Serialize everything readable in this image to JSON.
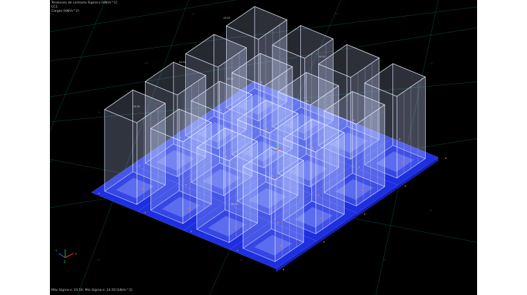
{
  "info": {
    "line1": "Tensiones de contacto Sigma-z [kN/m^2]",
    "line2": "CC1",
    "line3": "Cargas [kN/m^2]"
  },
  "status": {
    "text": "Máx Sigma-z: 24.50, Mín Sigma-z: 24.50 [kN/m^2]"
  },
  "value_labels": [
    "24.50",
    "24.50",
    "24.50",
    "24.50",
    "24.50",
    "24.50"
  ],
  "axis": {
    "x": "X",
    "y": "Y",
    "z": "Z"
  },
  "colors": {
    "background": "#000000",
    "slab": "#1e2fe0",
    "tile_light": "#6f82f5",
    "stress_box": "#c8d4ff",
    "grid": "#0c8a7a",
    "marker": "#d26a1e"
  }
}
